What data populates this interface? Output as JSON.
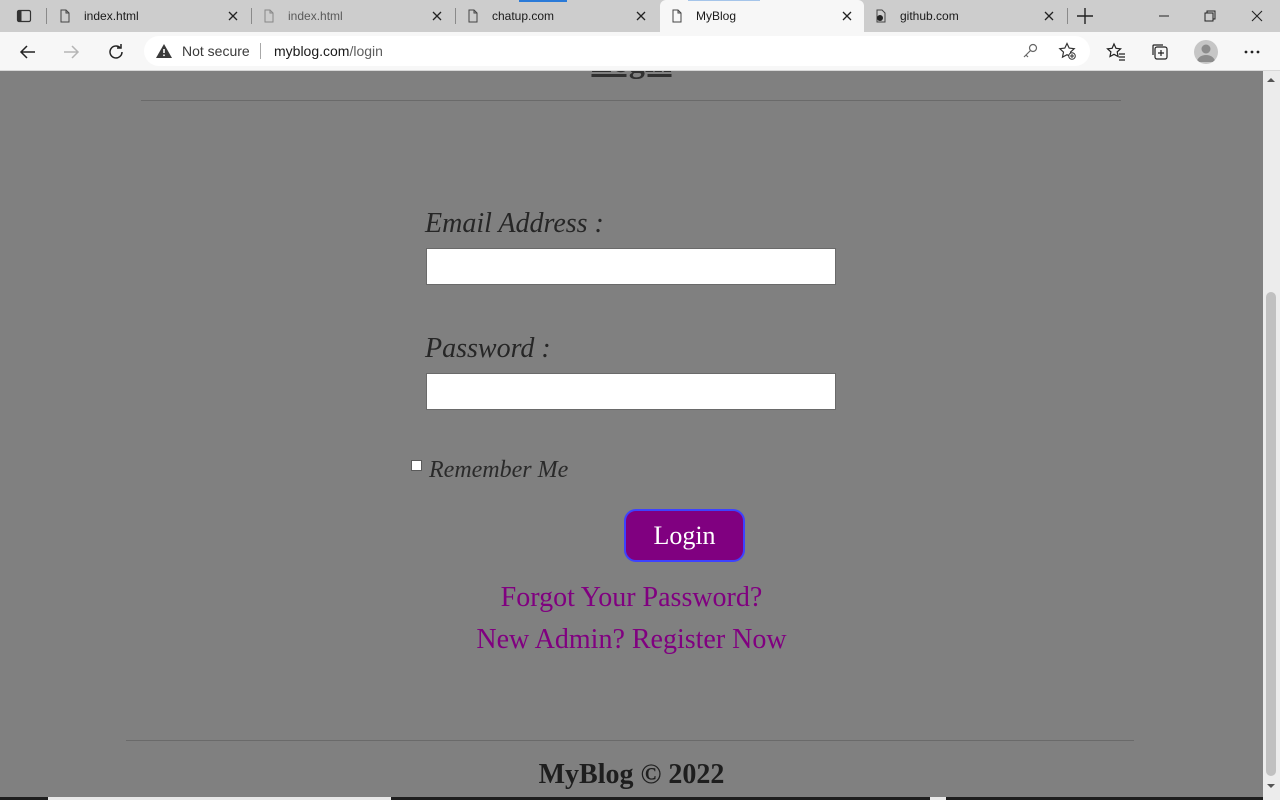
{
  "browser": {
    "tabs": [
      {
        "title": "index.html",
        "icon": "page-icon",
        "state": "normal"
      },
      {
        "title": "index.html",
        "icon": "page-icon",
        "state": "dim"
      },
      {
        "title": "chatup.com",
        "icon": "page-icon",
        "state": "normal"
      },
      {
        "title": "MyBlog",
        "icon": "page-icon",
        "state": "active"
      },
      {
        "title": "github.com",
        "icon": "github-icon",
        "state": "normal"
      }
    ],
    "address": {
      "security_label": "Not secure",
      "url_host": "myblog.com",
      "url_path": "/login"
    }
  },
  "page": {
    "heading": "Login",
    "email_label": "Email Address :",
    "email_value": "",
    "password_label": "Password :",
    "password_value": "",
    "remember_label": "Remember Me",
    "remember_checked": false,
    "login_button": "Login",
    "forgot_link": "Forgot Your Password?",
    "register_link": "New Admin? Register Now",
    "footer": "MyBlog © 2022"
  },
  "colors": {
    "page_bg": "#808080",
    "accent": "#800080",
    "button_border": "#3d42ff"
  }
}
